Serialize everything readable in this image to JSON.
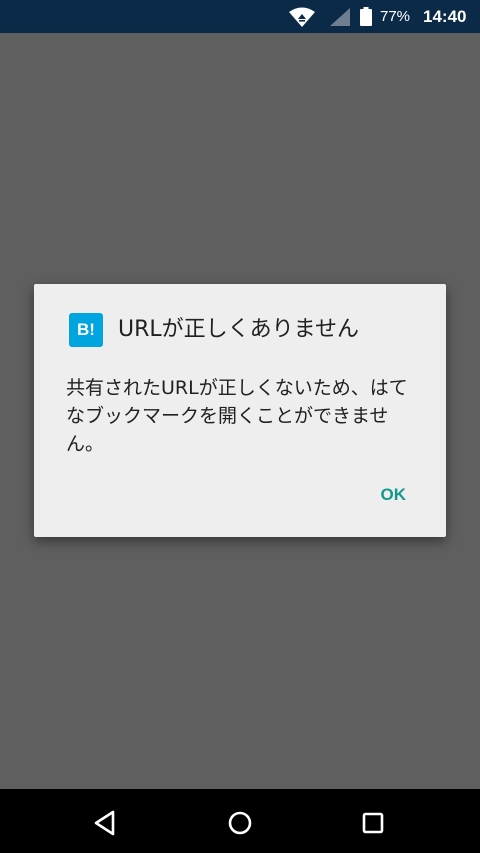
{
  "status_bar": {
    "battery_percent": "77%",
    "time": "14:40",
    "icons": [
      "wifi-icon",
      "signal-icon",
      "battery-icon"
    ]
  },
  "dialog": {
    "icon_text": "B!",
    "title": "URLが正しくありません",
    "message": "共有されたURLが正しくないため、はてなブックマークを開くことができません。",
    "ok_label": "OK",
    "accent_color": "#139a8a",
    "icon_color": "#00a4de"
  },
  "nav_bar": {
    "icons": [
      "back-icon",
      "home-icon",
      "recents-icon"
    ]
  }
}
